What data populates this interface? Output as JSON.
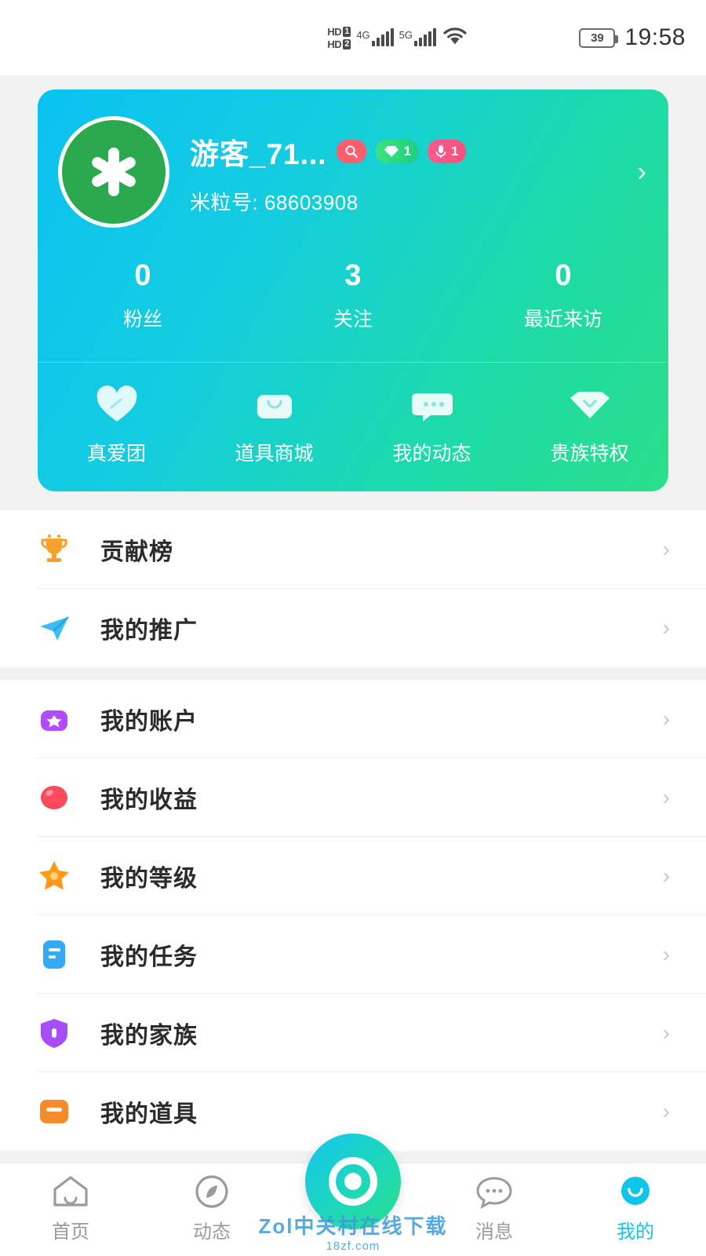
{
  "status_bar": {
    "hd1_label": "HD",
    "hd1_num": "1",
    "hd2_label": "HD",
    "hd2_num": "2",
    "net1": "4G",
    "net2": "5G",
    "wifi_icon": "wifi-icon",
    "battery_level": "39",
    "time": "19:58"
  },
  "profile": {
    "avatar_icon": "asterisk-avatar",
    "username": "游客_71...",
    "badges": [
      {
        "icon": "search-badge-icon",
        "text": ""
      },
      {
        "icon": "diamond-icon",
        "text": "1"
      },
      {
        "icon": "mic-icon",
        "text": "1"
      }
    ],
    "mili_label": "米粒号:",
    "mili_value": "68603908",
    "chevron_icon": "chevron-right-icon",
    "stats": [
      {
        "value": "0",
        "label": "粉丝"
      },
      {
        "value": "3",
        "label": "关注"
      },
      {
        "value": "0",
        "label": "最近来访"
      }
    ],
    "quick_actions": [
      {
        "icon": "heart-icon",
        "label": "真爱团"
      },
      {
        "icon": "shop-bag-icon",
        "label": "道具商城"
      },
      {
        "icon": "chat-bubble-icon",
        "label": "我的动态"
      },
      {
        "icon": "gem-icon",
        "label": "贵族特权"
      }
    ]
  },
  "menu_groups": [
    {
      "items": [
        {
          "icon": "trophy-icon",
          "label": "贡献榜",
          "color": "#f7a12a"
        },
        {
          "icon": "paper-plane-icon",
          "label": "我的推广",
          "color": "#3dbdf5"
        }
      ]
    },
    {
      "items": [
        {
          "icon": "wallet-icon",
          "label": "我的账户",
          "color": "#b04bff"
        },
        {
          "icon": "coin-icon",
          "label": "我的收益",
          "color": "#fb4a5e"
        },
        {
          "icon": "star-icon",
          "label": "我的等级",
          "color": "#ff9a18"
        },
        {
          "icon": "task-icon",
          "label": "我的任务",
          "color": "#33aaf5"
        },
        {
          "icon": "shield-icon",
          "label": "我的家族",
          "color": "#a64cf8"
        },
        {
          "icon": "box-icon",
          "label": "我的道具",
          "color": "#f58b2a"
        }
      ]
    }
  ],
  "tabbar": {
    "items": [
      {
        "icon": "home-icon",
        "label": "首页",
        "active": false
      },
      {
        "icon": "compass-icon",
        "label": "动态",
        "active": false
      },
      {
        "icon": "live-eye-icon",
        "label": "",
        "active": false
      },
      {
        "icon": "message-icon",
        "label": "消息",
        "active": false
      },
      {
        "icon": "profile-icon",
        "label": "我的",
        "active": true
      }
    ]
  },
  "watermark": {
    "main": "Zol中关村在线下载",
    "sub": "18zf.com"
  },
  "chevron": "›"
}
